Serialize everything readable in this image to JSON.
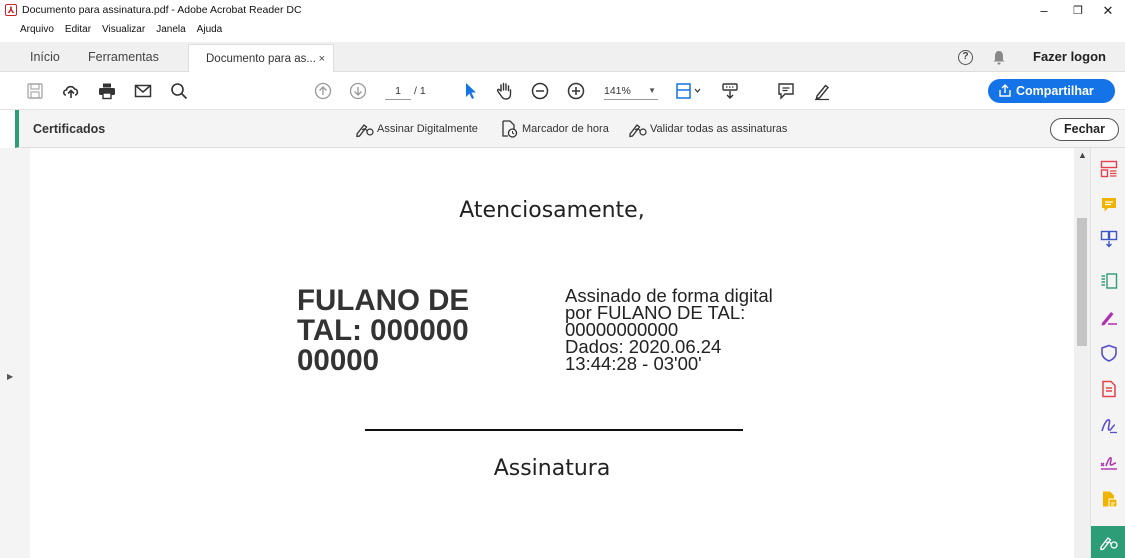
{
  "window": {
    "title": "Documento para assinatura.pdf - Adobe Acrobat Reader DC",
    "controls": {
      "minimize": "–",
      "maximize": "❐",
      "close": "✕"
    }
  },
  "menu": [
    "Arquivo",
    "Editar",
    "Visualizar",
    "Janela",
    "Ajuda"
  ],
  "tabs": {
    "home": "Início",
    "tools": "Ferramentas",
    "document": "Documento para as...",
    "document_close": "×",
    "logon": "Fazer logon"
  },
  "toolbar": {
    "page_current": "1",
    "page_total": "/ 1",
    "zoom": "141%",
    "share": "Compartilhar"
  },
  "certificates_bar": {
    "label": "Certificados",
    "sign_digitally": "Assinar Digitalmente",
    "timestamp": "Marcador de hora",
    "validate_all": "Validar todas as assinaturas",
    "close": "Fechar"
  },
  "document": {
    "greeting": "Atenciosamente,",
    "signer_name": "FULANO DE TAL: 000000 00000",
    "signature_details": [
      "Assinado de forma digital",
      "por FULANO DE TAL:",
      "00000000000",
      "Dados: 2020.06.24",
      "13:44:28 - 03'00'"
    ],
    "signature_label": "Assinatura"
  },
  "colors": {
    "accent": "#1473e6",
    "cert_accent": "#2d9d78",
    "acrobat_red": "#c8232c"
  },
  "right_rail_icons": [
    "organize-pages-icon",
    "comment-icon",
    "combine-files-icon",
    "edit-pdf-icon",
    "fill-sign-icon",
    "protect-icon",
    "export-pdf-icon",
    "request-signature-icon",
    "signature-icon",
    "create-pdf-icon",
    "certificates-icon"
  ]
}
